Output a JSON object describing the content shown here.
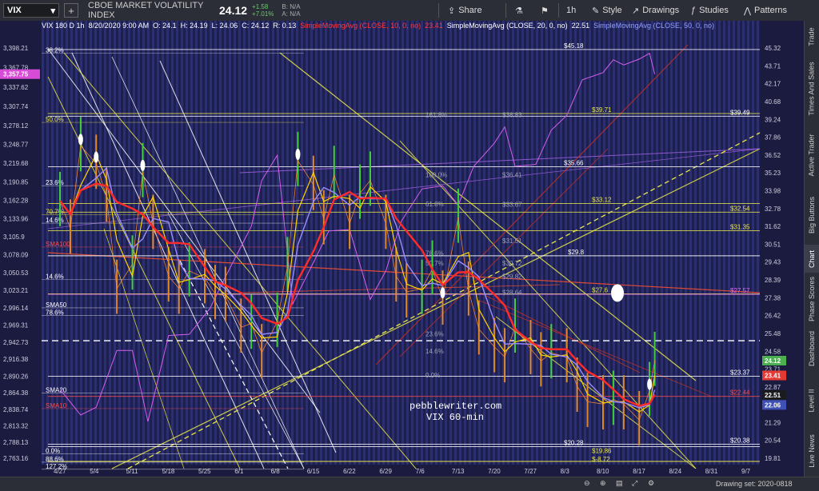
{
  "toolbar": {
    "symbol": "VIX",
    "name": "CBOE MARKET VOLATILITY INDEX",
    "price": "24.12",
    "change": "+1.58",
    "change_pct": "+7.01%",
    "bid": "B: N/A",
    "ask": "A: N/A",
    "share": "Share",
    "interval": "1h",
    "style": "Style",
    "drawings": "Drawings",
    "studies": "Studies",
    "patterns": "Patterns"
  },
  "legend": {
    "label": "VIX 180 D 1h",
    "date": "8/20/2020 9:00 AM",
    "open": "O: 24.1",
    "high": "H: 24.19",
    "low": "L: 24.06",
    "close": "C: 24.12",
    "range": "R: 0.13",
    "sma10": "SimpleMovingAvg (CLOSE, 10, 0, no)",
    "sma10_val": "23.41",
    "sma20": "SimpleMovingAvg (CLOSE, 20, 0, no)",
    "sma20_val": "22.51",
    "sma50": "SimpleMovingAvg (CLOSE, 50, 0, no)"
  },
  "right_panel": [
    "Trade",
    "Times And Sales",
    "Active Trader",
    "Big Buttons",
    "Chart",
    "Phase Scores",
    "Dashboard",
    "Level II",
    "Live News"
  ],
  "bottom": {
    "drawing_set": "Drawing set: 2020-0818"
  },
  "watermark": [
    "pebblewriter.com",
    "VIX 60-min"
  ],
  "colors": {
    "bg": "#1e1f4a",
    "stripe": "#2c2f6e",
    "sma10": "#ff2a2a",
    "sma20": "#ffd400",
    "sma50": "#9a8cff",
    "spx": "#d65ff0",
    "fib_white": "#ffffff",
    "fib_yellow": "#e8e84a"
  },
  "chart_data": {
    "type": "line",
    "title": "VIX 60-min",
    "x_ticks": [
      "4/27",
      "5/4",
      "5/11",
      "5/18",
      "5/25",
      "6/1",
      "6/8",
      "6/15",
      "6/22",
      "6/29",
      "7/6",
      "7/13",
      "7/20",
      "7/27",
      "8/3",
      "8/10",
      "8/17",
      "8/24",
      "8/31",
      "9/7"
    ],
    "right_axis_ticks": [
      "45.32",
      "43.71",
      "42.17",
      "40.68",
      "39.24",
      "37.86",
      "36.52",
      "35.23",
      "33.98",
      "32.78",
      "31.62",
      "30.51",
      "29.43",
      "28.39",
      "27.38",
      "26.42",
      "25.48",
      "24.58",
      "23.71",
      "22.87",
      "22.06",
      "21.29",
      "20.54",
      "19.81"
    ],
    "left_axis_ticks": [
      "3,398.21",
      "3,367.78",
      "3,337.62",
      "3,307.74",
      "3,278.12",
      "3,248.77",
      "3,219.68",
      "3,190.85",
      "3,162.28",
      "3,133.96",
      "3,105.9",
      "3,078.09",
      "3,050.53",
      "3,023.21",
      "2,996.14",
      "2,969.31",
      "2,942.73",
      "2,916.38",
      "2,890.26",
      "2,864.38",
      "2,838.74",
      "2,813.32",
      "2,788.13",
      "2,763.16"
    ],
    "right_axis_log": true,
    "right_axis_range": [
      19.81,
      45.32
    ],
    "left_axis_range": [
      2763.16,
      3398.21
    ],
    "left_price_badge": "3,357.75",
    "right_price_badges": [
      {
        "value": 24.12,
        "label": "24.12",
        "color": "#4caf50"
      },
      {
        "value": 23.41,
        "label": "23.41",
        "color": "#e53935"
      },
      {
        "value": 22.51,
        "label": "22.51",
        "color": "#1b1c20"
      },
      {
        "value": 22.06,
        "label": "22.06",
        "color": "#3f51b5"
      }
    ],
    "vix_series": [
      [
        "4/27",
        33.3
      ],
      [
        "4/29",
        31.5
      ],
      [
        "5/1",
        37.2
      ],
      [
        "5/4",
        35.9
      ],
      [
        "5/6",
        33.6
      ],
      [
        "5/8",
        27.9
      ],
      [
        "5/11",
        29.3
      ],
      [
        "5/13",
        35.3
      ],
      [
        "5/15",
        31.8
      ],
      [
        "5/18",
        28.6
      ],
      [
        "5/20",
        27.9
      ],
      [
        "5/22",
        28.9
      ],
      [
        "5/25",
        28.5
      ],
      [
        "5/27",
        27.6
      ],
      [
        "5/29",
        27.5
      ],
      [
        "6/1",
        25.8
      ],
      [
        "6/3",
        26.0
      ],
      [
        "6/5",
        24.5
      ],
      [
        "6/8",
        26.1
      ],
      [
        "6/10",
        29.2
      ],
      [
        "6/12",
        36.1
      ],
      [
        "6/15",
        34.4
      ],
      [
        "6/17",
        32.1
      ],
      [
        "6/19",
        35.1
      ],
      [
        "6/22",
        31.8
      ],
      [
        "6/24",
        33.8
      ],
      [
        "6/26",
        34.7
      ],
      [
        "6/29",
        31.8
      ],
      [
        "7/1",
        28.6
      ],
      [
        "7/3",
        27.7
      ],
      [
        "7/6",
        27.9
      ],
      [
        "7/8",
        29.0
      ],
      [
        "7/10",
        27.3
      ],
      [
        "7/13",
        32.2
      ],
      [
        "7/15",
        27.8
      ],
      [
        "7/17",
        25.7
      ],
      [
        "7/20",
        24.8
      ],
      [
        "7/22",
        24.3
      ],
      [
        "7/24",
        25.8
      ],
      [
        "7/27",
        24.7
      ],
      [
        "7/29",
        24.1
      ],
      [
        "7/31",
        24.5
      ],
      [
        "8/3",
        24.3
      ],
      [
        "8/5",
        22.9
      ],
      [
        "8/7",
        22.2
      ],
      [
        "8/10",
        22.1
      ],
      [
        "8/12",
        22.3
      ],
      [
        "8/14",
        22.1
      ],
      [
        "8/17",
        21.4
      ],
      [
        "8/19",
        22.7
      ],
      [
        "8/20",
        24.12
      ]
    ],
    "spx_series": [
      [
        "4/27",
        2870
      ],
      [
        "5/1",
        2830
      ],
      [
        "5/4",
        2842
      ],
      [
        "5/8",
        2930
      ],
      [
        "5/11",
        2930
      ],
      [
        "5/14",
        2820
      ],
      [
        "5/18",
        2953
      ],
      [
        "5/22",
        2955
      ],
      [
        "5/26",
        2995
      ],
      [
        "5/29",
        3044
      ],
      [
        "6/3",
        3122
      ],
      [
        "6/5",
        3193
      ],
      [
        "6/8",
        3232
      ],
      [
        "6/11",
        3002
      ],
      [
        "6/15",
        3066
      ],
      [
        "6/18",
        3115
      ],
      [
        "6/22",
        3117
      ],
      [
        "6/26",
        3009
      ],
      [
        "6/29",
        3053
      ],
      [
        "7/2",
        3130
      ],
      [
        "7/6",
        3180
      ],
      [
        "7/10",
        3185
      ],
      [
        "7/13",
        3155
      ],
      [
        "7/16",
        3215
      ],
      [
        "7/20",
        3251
      ],
      [
        "7/22",
        3276
      ],
      [
        "7/24",
        3215
      ],
      [
        "7/28",
        3218
      ],
      [
        "7/31",
        3271
      ],
      [
        "8/3",
        3294
      ],
      [
        "8/6",
        3349
      ],
      [
        "8/10",
        3360
      ],
      [
        "8/12",
        3380
      ],
      [
        "8/14",
        3372
      ],
      [
        "8/17",
        3381
      ],
      [
        "8/19",
        3390
      ],
      [
        "8/20",
        3357.75
      ]
    ],
    "fib_labels": [
      {
        "text": "38.2%",
        "price": 3390
      },
      {
        "text": "50.0%",
        "price": 3283
      },
      {
        "text": "23.6%",
        "price": 3185
      },
      {
        "text": "70.7%",
        "price": 3140
      },
      {
        "text": "14.6%",
        "price": 3127
      },
      {
        "text": "SMA100",
        "price": 3090
      },
      {
        "text": "14.6%",
        "price": 3040
      },
      {
        "text": "SMA50",
        "price": 2996
      },
      {
        "text": "78.6%",
        "price": 2984
      },
      {
        "text": "SMA20",
        "price": 2864
      },
      {
        "text": "SMA10",
        "price": 2840
      },
      {
        "text": "0.0%",
        "price": 2770
      },
      {
        "text": "88.6%",
        "price": 2757
      },
      {
        "text": "127.2%",
        "price": 2746
      }
    ],
    "mid_fib_labels": [
      {
        "text": "161.8%",
        "price": 3290
      },
      {
        "text": "100.0%",
        "price": 3197
      },
      {
        "text": "61.8%",
        "price": 3152
      },
      {
        "text": "78.6%",
        "price": 3076
      },
      {
        "text": "50.7%",
        "price": 3060
      },
      {
        "text": "23.6%",
        "price": 2951
      },
      {
        "text": "14.6%",
        "price": 2924
      },
      {
        "text": "0.0%",
        "price": 2887
      },
      {
        "text": "$38.83",
        "price": 3290
      },
      {
        "text": "$36.41",
        "price": 3197
      },
      {
        "text": "$33.67",
        "price": 3151
      },
      {
        "text": "$31.51",
        "price": 3095
      },
      {
        "text": "$30.72",
        "price": 3060
      },
      {
        "text": "$29.82",
        "price": 3040
      },
      {
        "text": "$28.64",
        "price": 3015
      }
    ],
    "vix_levels": [
      {
        "value": 45.18,
        "label": "$45.18",
        "color": "#ffffff"
      },
      {
        "value": 39.71,
        "label": "$39.71",
        "color": "#e8e84a"
      },
      {
        "value": 39.49,
        "label": "$39.49",
        "color": "#ffffff"
      },
      {
        "value": 35.66,
        "label": "$35.66",
        "color": "#ffffff"
      },
      {
        "value": 33.12,
        "label": "$33.12",
        "color": "#e8e84a"
      },
      {
        "value": 32.54,
        "label": "$32.54",
        "color": "#e8e84a"
      },
      {
        "value": 31.35,
        "label": "$31.35",
        "color": "#e8e84a"
      },
      {
        "value": 29.8,
        "label": "$29.8",
        "color": "#ffffff"
      },
      {
        "value": 27.6,
        "label": "$27.6",
        "color": "#e8e84a"
      },
      {
        "value": 27.57,
        "label": "$27.57",
        "color": "#e06aff"
      },
      {
        "value": 23.37,
        "label": "$23.37",
        "color": "#ffffff"
      },
      {
        "value": 22.44,
        "label": "$22.44",
        "color": "#ff4a4a"
      },
      {
        "value": 20.28,
        "label": "$20.28",
        "color": "#ffffff"
      },
      {
        "value": 20.38,
        "label": "$20.38",
        "color": "#ffffff"
      },
      {
        "value": 19.86,
        "label": "$19.86",
        "color": "#e8e84a"
      },
      {
        "value": 8.72,
        "label": "$-8.72",
        "color": "#e8e84a"
      }
    ]
  }
}
